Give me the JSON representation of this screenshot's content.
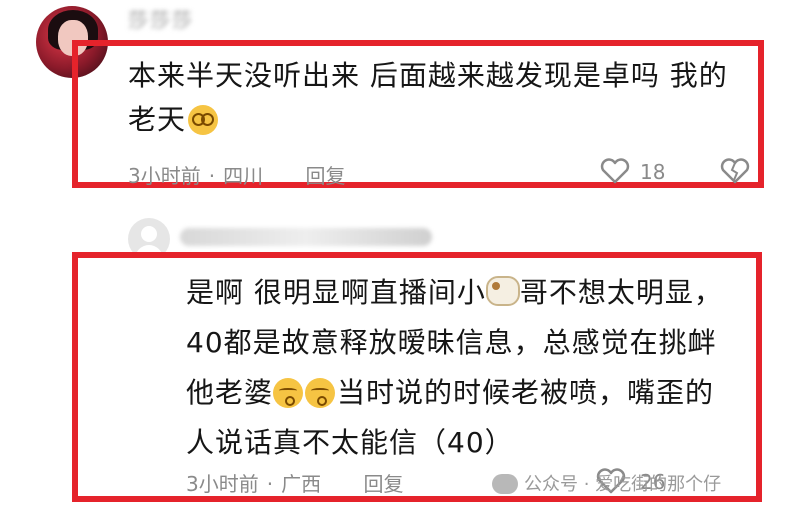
{
  "comment1": {
    "username": "莎莎莎",
    "text_line1": "本来半天没听出来 后面越来越发现是卓吗 我的",
    "text_line2": "老天",
    "time": "3小时前",
    "location": "四川",
    "reply_label": "回复",
    "likes": "18"
  },
  "comment2": {
    "text_line1a": "是啊 很明显啊直播间小",
    "text_line1b": "哥不想太明显，",
    "text_line2": "40都是故意释放暧昧信息，总感觉在挑衅",
    "text_line3a": "他老婆",
    "text_line3b": "当时说的时候老被喷，嘴歪的",
    "text_line4": "人说话真不太能信（40）",
    "time": "3小时前",
    "location": "广西",
    "reply_label": "回复",
    "likes": "26"
  },
  "watermark": {
    "text": "公众号 · 爱吃街的那个仔"
  },
  "colors": {
    "highlight": "#e5232b",
    "meta": "#8a8a8a",
    "text": "#161616"
  },
  "icons": [
    "avatar",
    "dizzy-face-emoji",
    "ram-emoji",
    "kissing-face-emoji",
    "heart-icon",
    "dislike-heart-icon",
    "wechat-icon"
  ]
}
